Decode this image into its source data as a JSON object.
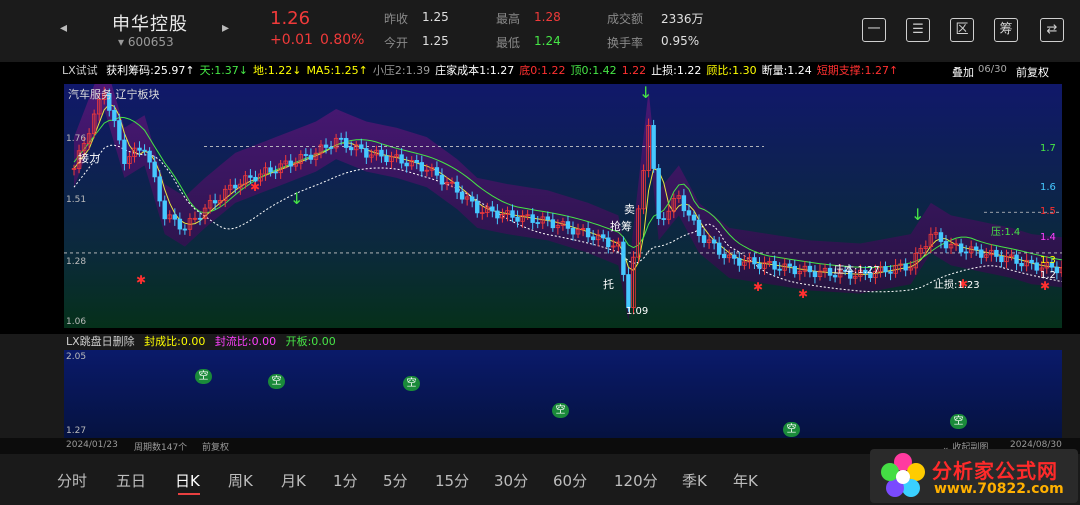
{
  "header": {
    "back_glyph": "◂",
    "forward_glyph": "▸",
    "stock_name": "申华控股",
    "stock_code": "600653",
    "code_prefix": "▾",
    "price": "1.26",
    "change": "+0.01",
    "change_pct": "0.80%",
    "quotes": [
      {
        "label": "昨收",
        "value": "1.25"
      },
      {
        "label": "今开",
        "value": "1.25"
      },
      {
        "label": "最高",
        "value": "1.28"
      },
      {
        "label": "最低",
        "value": "1.24"
      },
      {
        "label": "成交额",
        "value": "2336万"
      },
      {
        "label": "换手率",
        "value": "0.95%"
      }
    ],
    "buttons": [
      "一",
      "☰",
      "区",
      "筹",
      "⇄"
    ]
  },
  "indicator": {
    "name": "LX试试",
    "items": [
      {
        "text": "获利筹码:25.97↑",
        "color": "#ffffff"
      },
      {
        "text": "天:1.37↓",
        "color": "#46e646"
      },
      {
        "text": "地:1.22↓",
        "color": "#ffff00"
      },
      {
        "text": "MA5:1.25↑",
        "color": "#ffff00"
      },
      {
        "text": "小压2:1.39",
        "color": "#9a9a9a"
      },
      {
        "text": "庄家成本1:1.27",
        "color": "#ffffff"
      },
      {
        "text": "底0:1.22",
        "color": "#ff3030"
      },
      {
        "text": "顶0:1.42",
        "color": "#46e646"
      },
      {
        "text": "1.22",
        "color": "#ff3030"
      },
      {
        "text": "止损:1.22",
        "color": "#ffffff"
      },
      {
        "text": "顾比:1.30",
        "color": "#ffff00"
      },
      {
        "text": "断量:1.24",
        "color": "#ffffff"
      },
      {
        "text": "短期支撑:1.27↑",
        "color": "#ff3030"
      }
    ],
    "overlay_label": "叠加",
    "date_right": "06/30",
    "fq_label": "前复权",
    "sector_tag": "汽车服务 辽宁板块"
  },
  "main_axis": {
    "left": [
      "1.76",
      "1.51",
      "1.28",
      "1.06"
    ],
    "right": [
      {
        "text": "1.7",
        "color": "#46e646"
      },
      {
        "text": "1.6",
        "color": "#46c8ff"
      },
      {
        "text": "1.5",
        "color": "#ff3030"
      },
      {
        "text": "1.4",
        "color": "#ff40ff"
      },
      {
        "text": "1.3",
        "color": "#ffff00"
      },
      {
        "text": "1.2",
        "color": "#ffffff"
      }
    ]
  },
  "annotations": {
    "zhuangben": "庄本:1.27",
    "zhisun": "止损:1.23",
    "ya": "压:1.4",
    "low_mark": "1.09",
    "jieli": "接力",
    "qiangchou": "抢筹",
    "mai": "卖",
    "tuo": "托"
  },
  "sub_indicator": {
    "name": "LX跳盘日删除",
    "items": [
      {
        "text": "封成比:0.00",
        "color": "#ffff00"
      },
      {
        "text": "封流比:0.00",
        "color": "#ff40ff"
      },
      {
        "text": "开板:0.00",
        "color": "#46e646"
      }
    ],
    "axis_top": "2.05",
    "axis_bottom": "1.27",
    "marker": "空"
  },
  "footer_bar": {
    "start_date": "2024/01/23",
    "period_count": "周期数147个",
    "fq": "前复权",
    "collapse": "收起副图",
    "end_date": "2024/08/30"
  },
  "tabs": [
    "分时",
    "五日",
    "日K",
    "周K",
    "月K",
    "1分",
    "5分",
    "15分",
    "30分",
    "60分",
    "120分",
    "季K",
    "年K"
  ],
  "active_tab": "日K",
  "watermark": {
    "text": "分析家公式网",
    "url": "www.70822.com"
  },
  "colors": {
    "up": "#f03a3a",
    "down": "#46c8ff",
    "accent_green": "#46e646"
  }
}
